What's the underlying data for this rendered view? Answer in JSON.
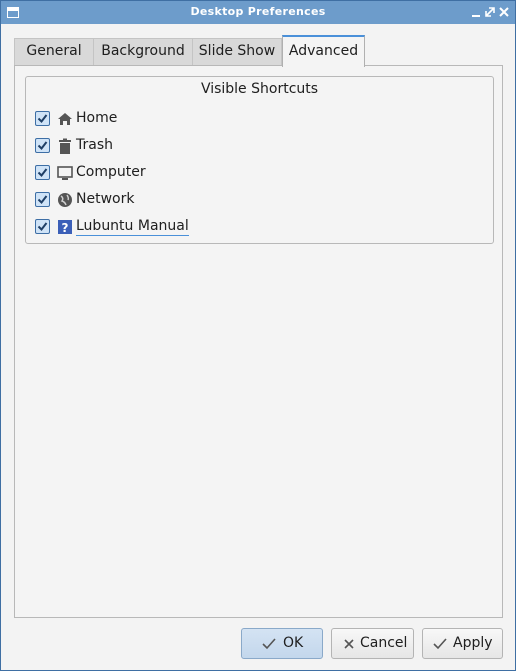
{
  "window": {
    "title": "Desktop Preferences"
  },
  "tabs": [
    {
      "label": "General"
    },
    {
      "label": "Background"
    },
    {
      "label": "Slide Show"
    },
    {
      "label": "Advanced",
      "active": true
    }
  ],
  "group": {
    "title": "Visible Shortcuts",
    "items": [
      {
        "label": "Home",
        "checked": true,
        "icon": "home-icon"
      },
      {
        "label": "Trash",
        "checked": true,
        "icon": "trash-icon"
      },
      {
        "label": "Computer",
        "checked": true,
        "icon": "computer-icon"
      },
      {
        "label": "Network",
        "checked": true,
        "icon": "network-icon"
      },
      {
        "label": "Lubuntu Manual",
        "checked": true,
        "icon": "help-icon"
      }
    ]
  },
  "buttons": {
    "ok": "OK",
    "cancel": "Cancel",
    "apply": "Apply"
  },
  "colors": {
    "titlebar": "#6d9ccb",
    "accent": "#4a90d9",
    "checkbox": "#3d6ea5"
  }
}
